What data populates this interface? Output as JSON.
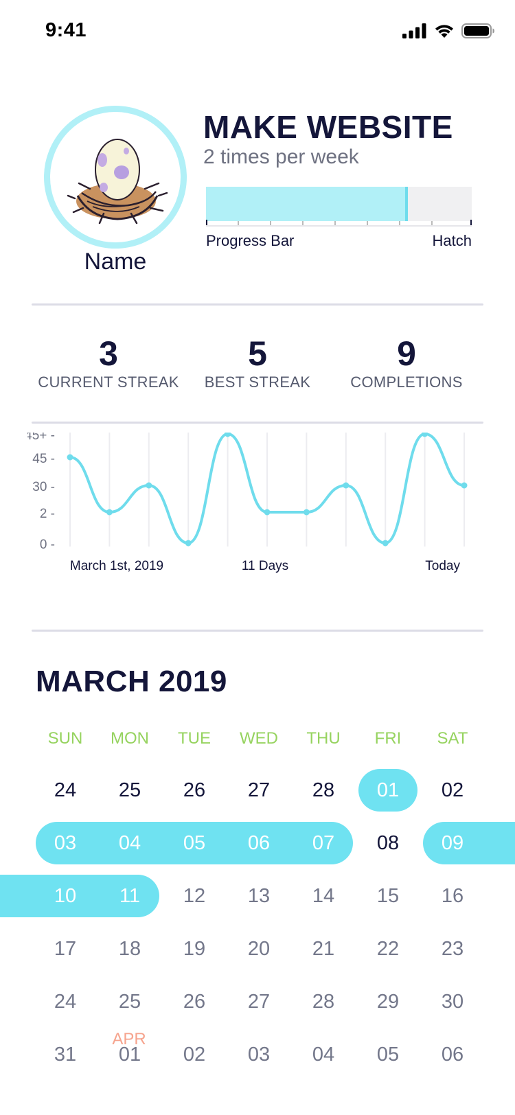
{
  "status": {
    "time": "9:41"
  },
  "profile": {
    "name": "Name"
  },
  "habit": {
    "title": "MAKE WEBSITE",
    "frequency": "2 times per week",
    "progress_fraction": 0.76,
    "progress_left_label": "Progress Bar",
    "progress_right_label": "Hatch"
  },
  "stats": [
    {
      "value": "3",
      "label": "CURRENT STREAK"
    },
    {
      "value": "5",
      "label": "BEST STREAK"
    },
    {
      "value": "9",
      "label": "COMPLETIONS"
    }
  ],
  "chart_data": {
    "type": "line",
    "y_ticks": [
      "0",
      "2",
      "30",
      "45",
      "45+"
    ],
    "x_labels": [
      "March 1st, 2019",
      "11 Days",
      "Today"
    ],
    "series": [
      {
        "values": [
          "45",
          "2",
          "30",
          "0",
          "45+",
          "2",
          "2",
          "30",
          "0",
          "45+",
          "30"
        ]
      }
    ],
    "grid": true,
    "line_color": "#6fdcec"
  },
  "calendar": {
    "title": "MARCH 2019",
    "weekdays": [
      "SUN",
      "MON",
      "TUE",
      "WED",
      "THU",
      "FRI",
      "SAT"
    ],
    "weeks": [
      [
        "24",
        "25",
        "26",
        "27",
        "28",
        "01",
        "02"
      ],
      [
        "03",
        "04",
        "05",
        "06",
        "07",
        "08",
        "09"
      ],
      [
        "10",
        "11",
        "12",
        "13",
        "14",
        "15",
        "16"
      ],
      [
        "17",
        "18",
        "19",
        "20",
        "21",
        "22",
        "23"
      ],
      [
        "24",
        "25",
        "26",
        "27",
        "28",
        "29",
        "30"
      ],
      [
        "31",
        "01",
        "02",
        "03",
        "04",
        "05",
        "06"
      ]
    ],
    "next_month_label": "APR",
    "completed_dates": [
      "01",
      "03",
      "04",
      "05",
      "06",
      "07",
      "09",
      "10",
      "11"
    ],
    "accent_color": "#6fe2f1",
    "weekday_color": "#96d35f"
  }
}
